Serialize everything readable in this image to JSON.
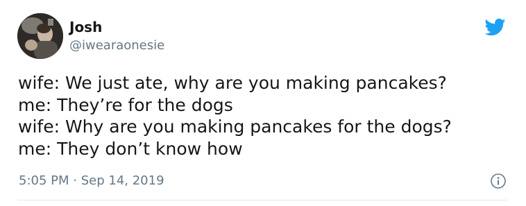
{
  "author": {
    "name": "Josh",
    "handle": "@iwearaonesie"
  },
  "tweet": {
    "lines": [
      "wife: We just ate, why are you making pancakes?",
      "me: They’re for the dogs",
      "wife: Why are you making pancakes for the dogs?",
      "me: They don’t know how"
    ]
  },
  "meta": {
    "time": "5:05 PM",
    "separator": "·",
    "date": "Sep 14, 2019"
  },
  "icons": {
    "brand": "twitter-bird-icon",
    "info": "info-icon"
  },
  "colors": {
    "brand": "#1da1f2",
    "text": "#14171a",
    "muted": "#657786"
  }
}
